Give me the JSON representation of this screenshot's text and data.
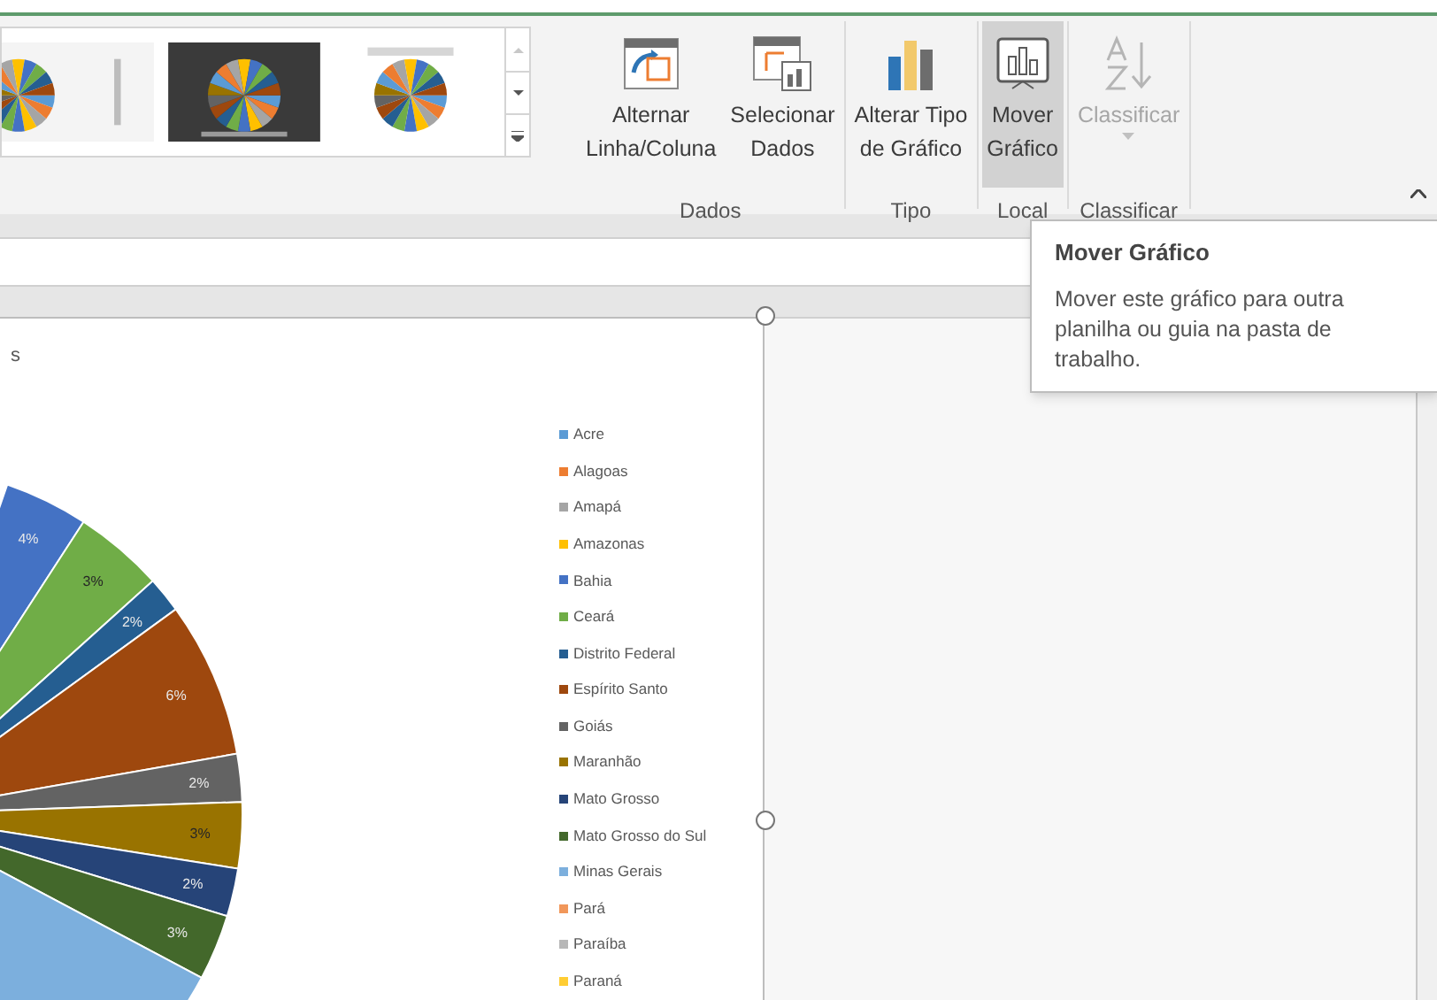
{
  "ribbon": {
    "gallery": {
      "thumbnails": [
        {
          "kind": "light"
        },
        {
          "kind": "dark"
        },
        {
          "kind": "plain"
        }
      ]
    },
    "groups": [
      {
        "label": "Dados",
        "buttons": [
          {
            "kind": "switch",
            "lines": [
              "Alternar",
              "Linha/Coluna"
            ],
            "selected": false,
            "disabled": false
          },
          {
            "kind": "select",
            "lines": [
              "Selecionar",
              "Dados"
            ],
            "selected": false,
            "disabled": false
          }
        ]
      },
      {
        "label": "Tipo",
        "buttons": [
          {
            "kind": "type",
            "lines": [
              "Alterar Tipo",
              "de Gráfico"
            ],
            "selected": false,
            "disabled": false
          }
        ]
      },
      {
        "label": "Local",
        "buttons": [
          {
            "kind": "move",
            "lines": [
              "Mover",
              "Gráfico"
            ],
            "selected": true,
            "disabled": false
          }
        ]
      },
      {
        "label": "Classificar",
        "buttons": [
          {
            "kind": "sort",
            "lines": [
              "Classificar"
            ],
            "selected": false,
            "disabled": true
          }
        ]
      }
    ]
  },
  "tooltip": {
    "title": "Mover Gráfico",
    "text": "Mover este gráfico para outra planilha ou guia na pasta de trabalho."
  },
  "chart": {
    "title": "s",
    "slices": [
      {
        "label": "4%",
        "color": "#4472c4"
      },
      {
        "label": "3%",
        "color": "#70ad47"
      },
      {
        "label": "2%",
        "color": "#255e91"
      },
      {
        "label": "6%",
        "color": "#9e480e"
      },
      {
        "label": "2%",
        "color": "#636363"
      },
      {
        "label": "3%",
        "color": "#997300"
      },
      {
        "label": "2%",
        "color": "#264478"
      },
      {
        "label": "3%",
        "color": "#43682b"
      },
      {
        "color": "#7cafdd"
      }
    ],
    "legend": [
      {
        "name": "Acre",
        "color": "#5b9bd5"
      },
      {
        "name": "Alagoas",
        "color": "#ed7d31"
      },
      {
        "name": "Amapá",
        "color": "#a5a5a5"
      },
      {
        "name": "Amazonas",
        "color": "#ffc000"
      },
      {
        "name": "Bahia",
        "color": "#4472c4"
      },
      {
        "name": "Ceará",
        "color": "#70ad47"
      },
      {
        "name": "Distrito Federal",
        "color": "#255e91"
      },
      {
        "name": "Espírito Santo",
        "color": "#9e480e"
      },
      {
        "name": "Goiás",
        "color": "#636363"
      },
      {
        "name": "Maranhão",
        "color": "#997300"
      },
      {
        "name": "Mato Grosso",
        "color": "#264478"
      },
      {
        "name": "Mato Grosso do Sul",
        "color": "#43682b"
      },
      {
        "name": "Minas Gerais",
        "color": "#7cafdd"
      },
      {
        "name": "Pará",
        "color": "#f1975a"
      },
      {
        "name": "Paraíba",
        "color": "#b7b7b7"
      },
      {
        "name": "Paraná",
        "color": "#ffcd33"
      }
    ]
  }
}
